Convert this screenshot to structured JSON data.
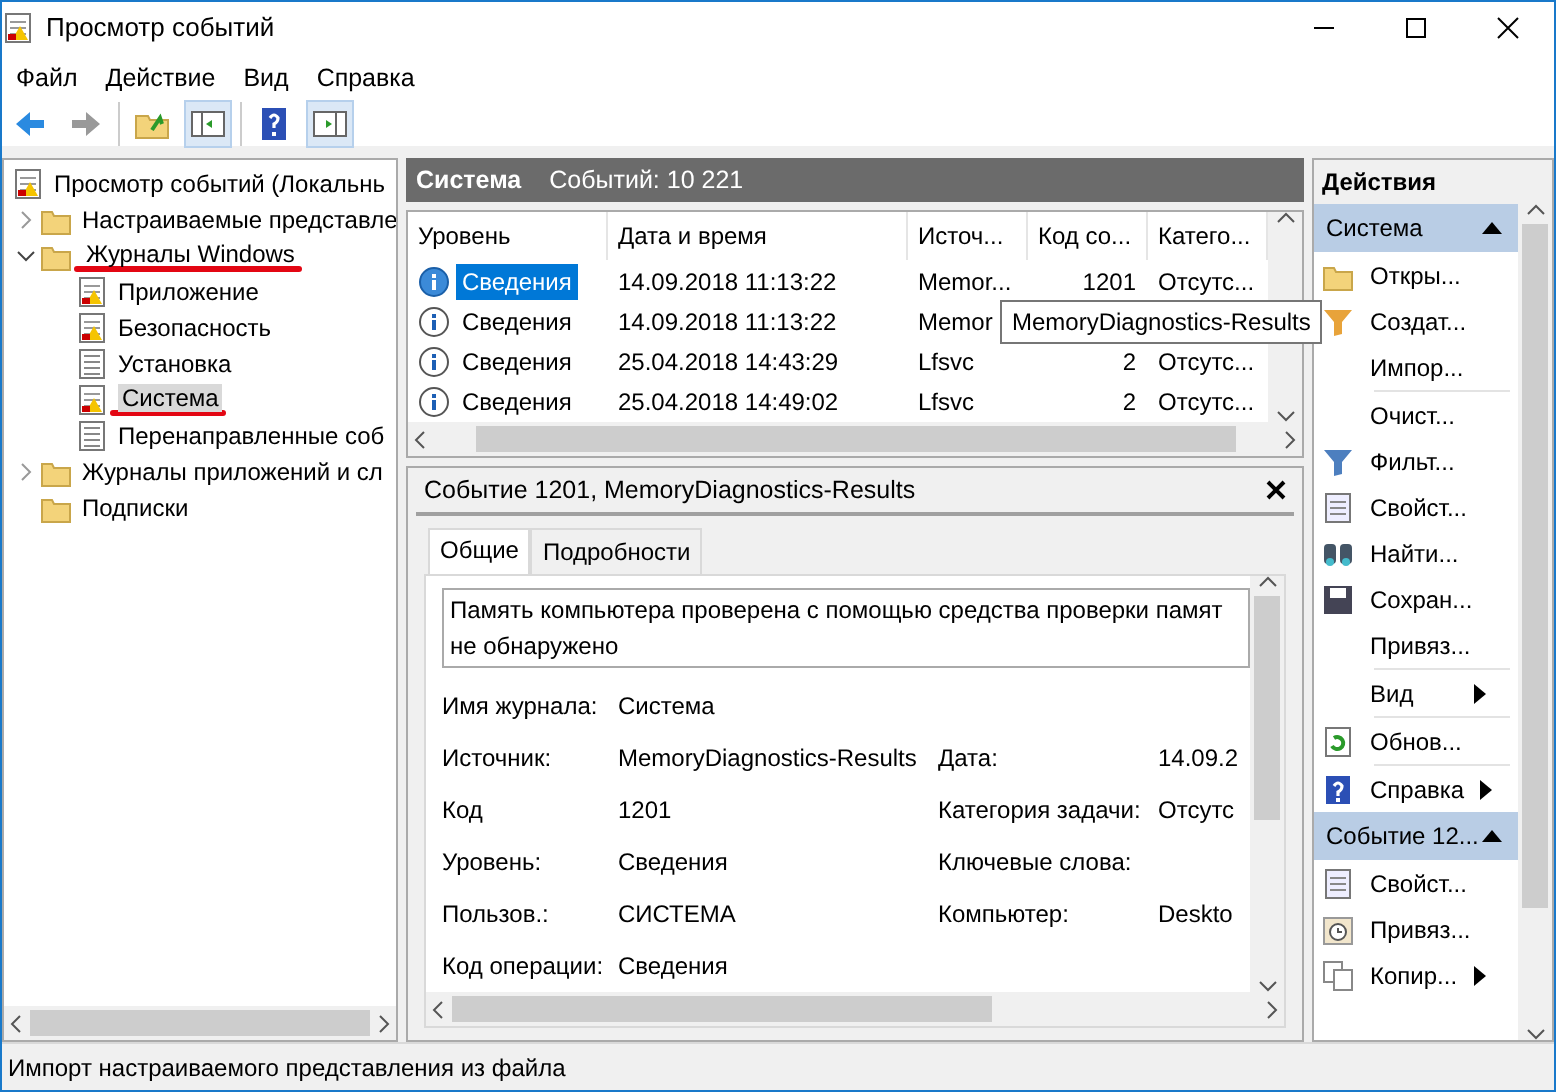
{
  "window": {
    "title": "Просмотр событий"
  },
  "menu": [
    "Файл",
    "Действие",
    "Вид",
    "Справка"
  ],
  "tree": {
    "label": "Просмотр событий (Локальнь",
    "children": [
      {
        "label": "Настраиваемые представле",
        "expanded": false
      },
      {
        "label": "Журналы Windows",
        "expanded": true,
        "underlined": true,
        "children": [
          {
            "label": "Приложение",
            "selected": false
          },
          {
            "label": "Безопасность",
            "selected": false
          },
          {
            "label": "Установка",
            "selected": false
          },
          {
            "label": "Система",
            "selected": true,
            "underlined": true
          },
          {
            "label": "Перенаправленные соб",
            "selected": false
          }
        ]
      },
      {
        "label": "Журналы приложений и сл",
        "expanded": false
      },
      {
        "label": "Подписки"
      }
    ]
  },
  "log_header": {
    "title": "Система",
    "count": "Событий: 10 221"
  },
  "events": {
    "columns": [
      "Уровень",
      "Дата и время",
      "Источ...",
      "Код со...",
      "Катего..."
    ],
    "rows": [
      {
        "level": "Сведения",
        "date": "14.09.2018 11:13:22",
        "source": "Memor...",
        "code": "1201",
        "category": "Отсутс...",
        "selected": true
      },
      {
        "level": "Сведения",
        "date": "14.09.2018 11:13:22",
        "source": "Memor",
        "selected": false
      },
      {
        "level": "Сведения",
        "date": "25.04.2018 14:43:29",
        "source": "Lfsvc",
        "code": "2",
        "category": "Отсутс...",
        "selected": false
      },
      {
        "level": "Сведения",
        "date": "25.04.2018 14:49:02",
        "source": "Lfsvc",
        "code": "2",
        "category": "Отсутс...",
        "selected": false
      }
    ],
    "tooltip": "MemoryDiagnostics-Results"
  },
  "details": {
    "title": "Событие 1201, MemoryDiagnostics-Results",
    "tabs": [
      {
        "label": "Общие",
        "selected": true
      },
      {
        "label": "Подробности",
        "selected": false
      }
    ],
    "message_lines": [
      "Память компьютера проверена с помощью средства проверки памят",
      "не обнаружено"
    ],
    "fields": [
      {
        "label": "Имя журнала:",
        "value": "Система"
      },
      {
        "label": "Источник:",
        "value": "MemoryDiagnostics-Results",
        "label_2": "Дата:",
        "value_2": "14.09.2"
      },
      {
        "label": "Код",
        "value": "1201",
        "label_2": "Категория задачи:",
        "value_2": "Отсутс"
      },
      {
        "label": "Уровень:",
        "value": "Сведения",
        "label_2": "Ключевые слова:"
      },
      {
        "label": "Пользов.:",
        "value": "СИСТЕМА",
        "label_2": "Компьютер:",
        "value_2": "Deskto"
      },
      {
        "label": "Код операции:",
        "value": "Сведения"
      }
    ]
  },
  "actions": {
    "title": "Действия",
    "items": [
      {
        "kind": "header",
        "label": "Система",
        "expanded": true
      },
      {
        "kind": "item",
        "label": "Откры..."
      },
      {
        "kind": "item",
        "label": "Создат..."
      },
      {
        "kind": "item",
        "label": "Импор..."
      },
      {
        "kind": "separator"
      },
      {
        "kind": "item",
        "label": "Очист..."
      },
      {
        "kind": "item",
        "label": "Фильт..."
      },
      {
        "kind": "item",
        "label": "Свойст..."
      },
      {
        "kind": "item",
        "label": "Найти..."
      },
      {
        "kind": "item",
        "label": "Сохран..."
      },
      {
        "kind": "item",
        "label": "Привяз..."
      },
      {
        "kind": "separator"
      },
      {
        "kind": "item",
        "label": "Вид",
        "submenu": true
      },
      {
        "kind": "separator"
      },
      {
        "kind": "item",
        "label": "Обнов..."
      },
      {
        "kind": "separator"
      },
      {
        "kind": "item",
        "label": "Справка",
        "submenu": true
      },
      {
        "kind": "header",
        "label": "Событие 12...",
        "expanded": true
      },
      {
        "kind": "item",
        "label": "Свойст..."
      },
      {
        "kind": "item",
        "label": "Привяз..."
      },
      {
        "kind": "item",
        "label": "Копир...",
        "submenu": true
      }
    ]
  },
  "status_bar": "Импорт настраиваемого представления из файла"
}
